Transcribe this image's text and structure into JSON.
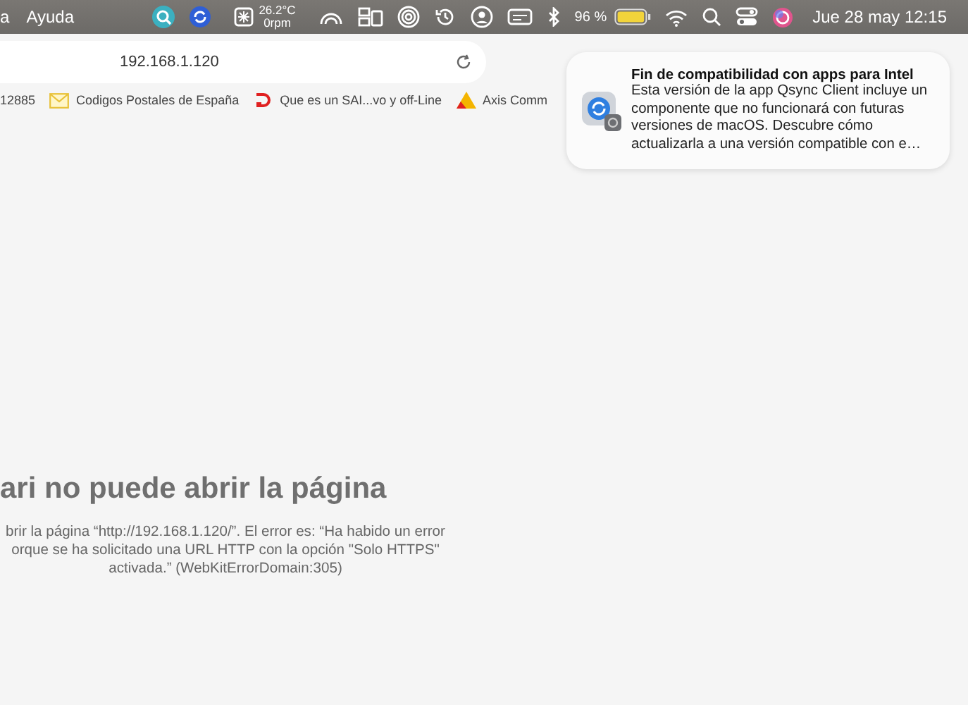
{
  "menu_bar": {
    "menus": [
      "a",
      "Ayuda"
    ],
    "temperature": "26.2°C",
    "fan_speed": "0rpm",
    "battery_percent": "96 %",
    "clock": "Jue 28 may 12:15"
  },
  "browser": {
    "address": "192.168.1.120",
    "bookmarks": [
      {
        "kind": "plain",
        "label": "12885"
      },
      {
        "kind": "mail",
        "label": "Codigos Postales de España"
      },
      {
        "kind": "d",
        "label": "Que es un SAI...vo y off-Line"
      },
      {
        "kind": "triangle",
        "label": "Axis Comm"
      }
    ],
    "error": {
      "title": "ari no puede abrir la página",
      "lines": [
        "brir la página “http://192.168.1.120/”. El error es: “Ha habido un error",
        "orque se ha solicitado una URL HTTP con la opción \"Solo HTTPS\"",
        "activada.” (WebKitErrorDomain:305)"
      ]
    }
  },
  "notification": {
    "title": "Fin de compatibilidad con apps para Intel",
    "body": "Esta versión de la app Qsync Client incluye un componente que no funcionará con futuras versiones de macOS. Descubre cómo actualizarla a una versión compatible con e…"
  }
}
